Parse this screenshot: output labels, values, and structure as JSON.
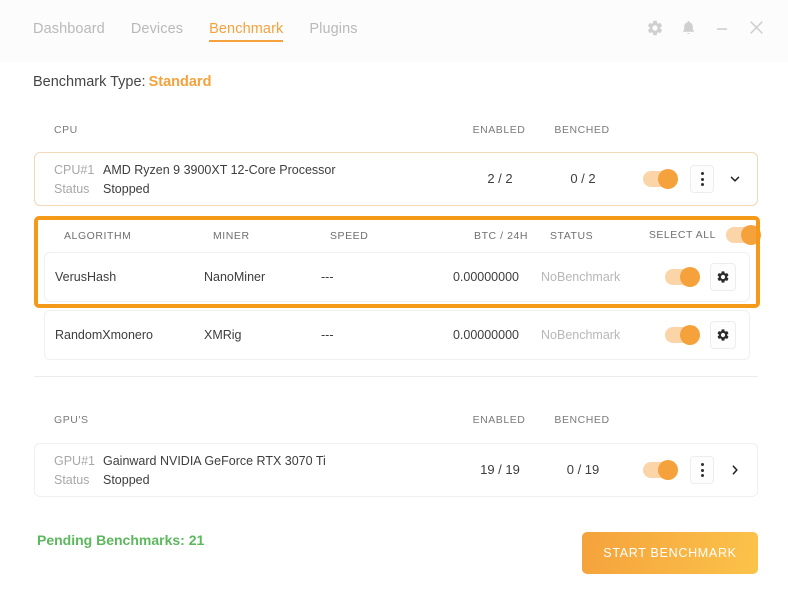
{
  "nav": {
    "items": [
      {
        "label": "Dashboard",
        "active": false
      },
      {
        "label": "Devices",
        "active": false
      },
      {
        "label": "Benchmark",
        "active": true
      },
      {
        "label": "Plugins",
        "active": false
      }
    ],
    "window_icons": [
      "gear-icon",
      "bell-icon",
      "minimize-icon",
      "close-icon"
    ]
  },
  "benchmark_type": {
    "label": "Benchmark Type:",
    "value": "Standard"
  },
  "cpu_section": {
    "header": {
      "device": "CPU",
      "enabled": "ENABLED",
      "benched": "BENCHED"
    },
    "device": {
      "id_label": "CPU#1",
      "name": "AMD Ryzen 9 3900XT 12-Core Processor",
      "status_label": "Status",
      "status_value": "Stopped",
      "enabled": "2 / 2",
      "benched": "0 / 2",
      "toggle_on": true,
      "expanded": true
    }
  },
  "algorithm_table": {
    "columns": {
      "algorithm": "ALGORITHM",
      "miner": "MINER",
      "speed": "SPEED",
      "btc": "BTC / 24H",
      "status": "STATUS",
      "select_all": "SELECT ALL"
    },
    "select_all_toggle_on": true,
    "rows": [
      {
        "algorithm": "VerusHash",
        "miner": "NanoMiner",
        "speed": "---",
        "btc": "0.00000000",
        "status": "NoBenchmark",
        "toggle_on": true
      },
      {
        "algorithm": "RandomXmonero",
        "miner": "XMRig",
        "speed": "---",
        "btc": "0.00000000",
        "status": "NoBenchmark",
        "toggle_on": true
      }
    ]
  },
  "gpu_section": {
    "header": {
      "device": "GPU'S",
      "enabled": "ENABLED",
      "benched": "BENCHED"
    },
    "device": {
      "id_label": "GPU#1",
      "name": "Gainward NVIDIA GeForce RTX 3070 Ti",
      "status_label": "Status",
      "status_value": "Stopped",
      "enabled": "19 / 19",
      "benched": "0 / 19",
      "toggle_on": true,
      "expanded": false
    }
  },
  "footer": {
    "pending_label": "Pending Benchmarks: 21",
    "start_button": "START BENCHMARK"
  },
  "colors": {
    "accent": "#f5a23c",
    "highlight": "#f59a18",
    "pending_green": "#5cb85c",
    "muted_text": "#b7b7b7"
  }
}
